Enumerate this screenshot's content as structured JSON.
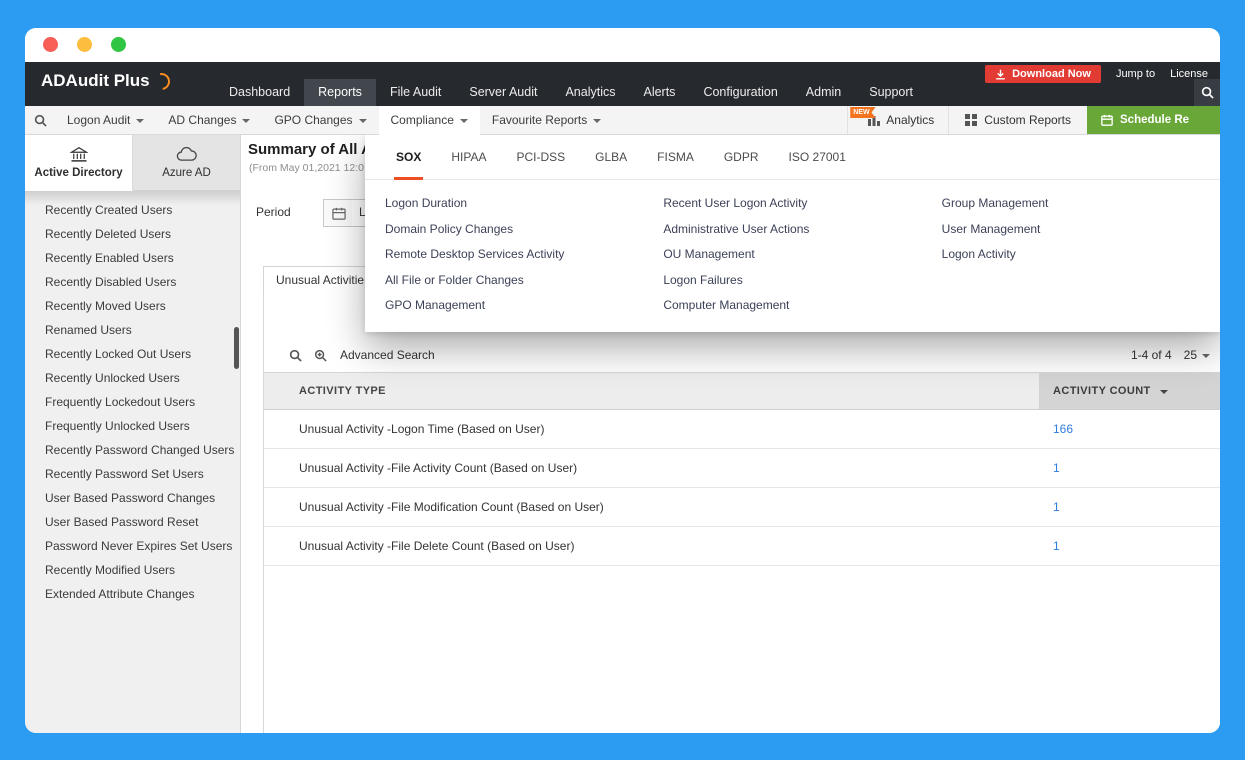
{
  "colors": {
    "frame_blue": "#2b9cf2",
    "header_dark": "#26292e",
    "accent_orange": "#ee4e24",
    "download_red": "#e23b33",
    "schedule_green": "#69a838",
    "count_link_blue": "#2e7ce0"
  },
  "window": {
    "controls": [
      "close",
      "minimize",
      "maximize"
    ]
  },
  "header": {
    "logo": "ADAudit Plus",
    "nav": [
      "Dashboard",
      "Reports",
      "File Audit",
      "Server Audit",
      "Analytics",
      "Alerts",
      "Configuration",
      "Admin",
      "Support"
    ],
    "active_nav": "Reports",
    "download_label": "Download Now",
    "jump_to_label": "Jump to",
    "license_label": "License"
  },
  "toolbar": {
    "menus": [
      "Logon Audit",
      "AD Changes",
      "GPO Changes",
      "Compliance",
      "Favourite Reports"
    ],
    "active_menu": "Compliance",
    "new_badge": "NEW",
    "analytics_label": "Analytics",
    "custom_reports_label": "Custom Reports",
    "schedule_label": "Schedule Re"
  },
  "sidebar": {
    "tabs": [
      "Active Directory",
      "Azure AD"
    ],
    "active_tab": "Active Directory",
    "items": [
      "Recently Created Users",
      "Recently Deleted Users",
      "Recently Enabled Users",
      "Recently Disabled Users",
      "Recently Moved Users",
      "Renamed Users",
      "Recently Locked Out Users",
      "Recently Unlocked Users",
      "Frequently Lockedout Users",
      "Frequently Unlocked Users",
      "Recently Password Changed Users",
      "Recently Password Set Users",
      "User Based Password Changes",
      "User Based Password Reset",
      "Password Never Expires Set Users",
      "Recently Modified Users",
      "Extended Attribute Changes"
    ]
  },
  "main": {
    "title": "Summary of All A",
    "subtitle": "(From May 01,2021 12:0",
    "period_label": "Period",
    "period_value": "L",
    "report_tab": "Unusual Activitie",
    "advanced_search_label": "Advanced Search",
    "pagination": "1-4 of 4",
    "page_size": "25",
    "table": {
      "columns": [
        "ACTIVITY TYPE",
        "ACTIVITY COUNT"
      ],
      "rows": [
        {
          "type": "Unusual Activity -Logon Time (Based on User)",
          "count": "166"
        },
        {
          "type": "Unusual Activity -File Activity Count (Based on User)",
          "count": "1"
        },
        {
          "type": "Unusual Activity -File Modification Count (Based on User)",
          "count": "1"
        },
        {
          "type": "Unusual Activity -File Delete Count (Based on User)",
          "count": "1"
        }
      ]
    }
  },
  "dropdown": {
    "tabs": [
      "SOX",
      "HIPAA",
      "PCI-DSS",
      "GLBA",
      "FISMA",
      "GDPR",
      "ISO 27001"
    ],
    "active_tab": "SOX",
    "columns": [
      [
        "Logon Duration",
        "Domain Policy Changes",
        "Remote Desktop Services Activity",
        "All File or Folder Changes",
        "GPO Management"
      ],
      [
        "Recent User Logon Activity",
        "Administrative User Actions",
        "OU Management",
        "Logon Failures",
        "Computer Management"
      ],
      [
        "Group Management",
        "User Management",
        "Logon Activity"
      ]
    ]
  },
  "icons": {
    "header_search": "magnifier",
    "toolbar_search": "magnifier",
    "download": "arrow-down-tray",
    "analytics": "bar-chart",
    "custom_reports": "grid",
    "schedule": "calendar",
    "active_directory": "bank-building",
    "azure_ad": "cloud",
    "period_calendar": "calendar",
    "advanced_search": "magnifier-plus",
    "sort": "caret-down",
    "menu_caret": "caret-down"
  }
}
